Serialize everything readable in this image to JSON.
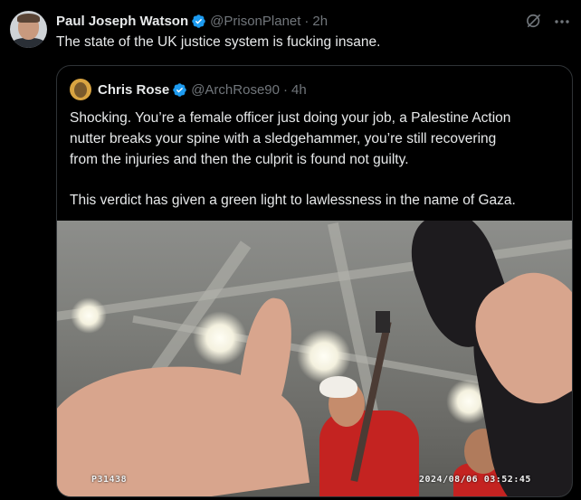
{
  "post": {
    "author_name": "Paul Joseph Watson",
    "handle": "@PrisonPlanet",
    "separator": "·",
    "time": "2h",
    "text": "The state of the UK justice system is fucking insane.",
    "icons": [
      "verified-badge-icon",
      "grok-icon",
      "more-icon"
    ]
  },
  "quoted": {
    "author_name": "Chris Rose",
    "handle": "@ArchRose90",
    "separator": "·",
    "time": "4h",
    "paragraph1_lines": [
      "Shocking. You’re a female officer just doing your job, a Palestine Action",
      "nutter breaks your spine with a sledgehammer, you’re still recovering",
      "from the injuries and then the culprit is found not guilty."
    ],
    "paragraph2": "This verdict has given a green light to lawlessness in the name of Gaza.",
    "media": {
      "type": "bodycam-image",
      "overlay_left": "P31438",
      "overlay_right": "2024/08/06  03:52:45"
    }
  },
  "colors": {
    "background": "#000000",
    "text": "#e7e9ea",
    "secondary": "#71767b",
    "verified_blue": "#1d9bf0",
    "border": "#2f3336"
  }
}
